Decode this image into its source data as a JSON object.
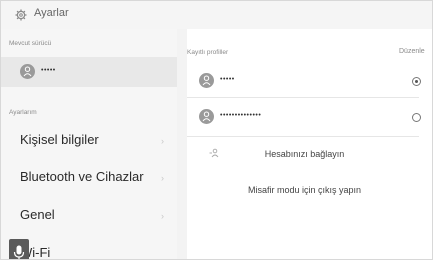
{
  "header": {
    "title": "Ayarlar",
    "icon": "gear-icon"
  },
  "left_panel": {
    "current_driver_label": "Mevcut sürücü",
    "current_driver_name": "•••••",
    "settings_label": "Ayarlarım",
    "menu_items": [
      {
        "label": "Kişisel bilgiler"
      },
      {
        "label": "Bluetooth ve Cihazlar"
      },
      {
        "label": "Genel"
      },
      {
        "label": "Wi-Fi"
      }
    ]
  },
  "right_panel": {
    "registered_profiles_label": "Kayıtlı profiller",
    "edit_label": "Düzenle",
    "profiles": [
      {
        "name": "•••••",
        "selected": true
      },
      {
        "name": "••••••••••••••",
        "selected": false
      }
    ],
    "link_account_label": "Hesabınızı bağlayın",
    "guest_logout_label": "Misafir modu için çıkış yapın"
  },
  "colors": {
    "highlight_row": "#e8e8e8",
    "avatar": "#9a9a9a",
    "mic_button": "#5a5a5a"
  }
}
